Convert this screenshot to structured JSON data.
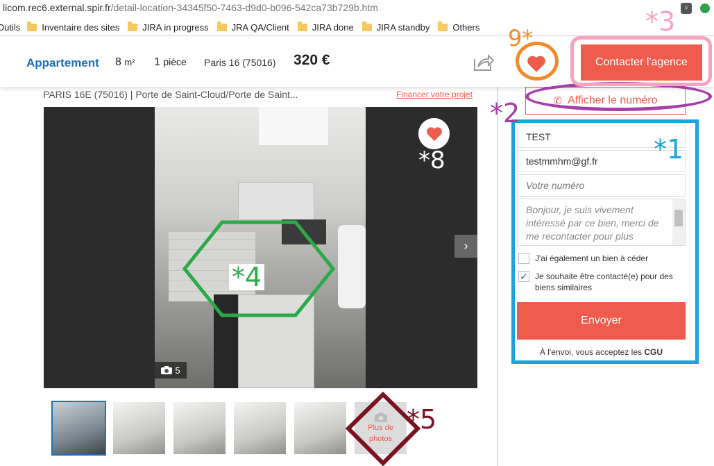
{
  "browser": {
    "url_host": "licom.rec6.external.spir.fr",
    "url_path": "/detail-location-34345f50-7463-d9d0-b096-542ca73b729b.htm"
  },
  "bookmarks": [
    {
      "label": "Outils"
    },
    {
      "label": "Inventaire des sites"
    },
    {
      "label": "JIRA in progress"
    },
    {
      "label": "JRA QA/Client"
    },
    {
      "label": "JIRA done"
    },
    {
      "label": "JIRA standby"
    },
    {
      "label": "Others"
    }
  ],
  "header": {
    "type": "Appartement",
    "surface_value": "8",
    "surface_unit": "m²",
    "rooms_value": "1",
    "rooms_unit": "pièce",
    "city": "Paris 16 (75016)",
    "price": "320 €",
    "contact_label": "Contacter l'agence"
  },
  "listing": {
    "breadcrumb": "PARIS 16E (75016) | Porte de Saint-Cloud/Porte de Saint...",
    "financer": "Financer votre projet",
    "photo_count": "5",
    "more_photos_line1": "Plus de",
    "more_photos_line2": "photos"
  },
  "form": {
    "show_number": "Afficher le numéro",
    "name_value": "TEST",
    "email_value": "testmmhm@gf.fr",
    "phone_placeholder": "Votre numéro",
    "message_placeholder": "Bonjour, je suis vivement intéressé par ce bien, merci de me recontacter pour plus d'informations.",
    "check1_label": "J'ai également un bien à céder",
    "check2_label": "Je souhaite être contacté(e) pour des biens similaires",
    "send_label": "Envoyer",
    "cgu_prefix": "À l'envoi, vous acceptez les",
    "cgu_link": "CGU"
  },
  "annotations": {
    "a1": "*1",
    "a2": "*2",
    "a3": "*3",
    "a4": "*4",
    "a5": "*5",
    "a8": "*8",
    "a9": "9*"
  },
  "colors": {
    "accent_red": "#ef5b4c",
    "brand_blue": "#1e6fb5",
    "ann1": "#1aa3e0",
    "ann2": "#a53ea8",
    "ann3": "#f6a3c2",
    "ann4": "#2aab47",
    "ann5": "#7b1222",
    "ann9": "#f28a2b"
  }
}
